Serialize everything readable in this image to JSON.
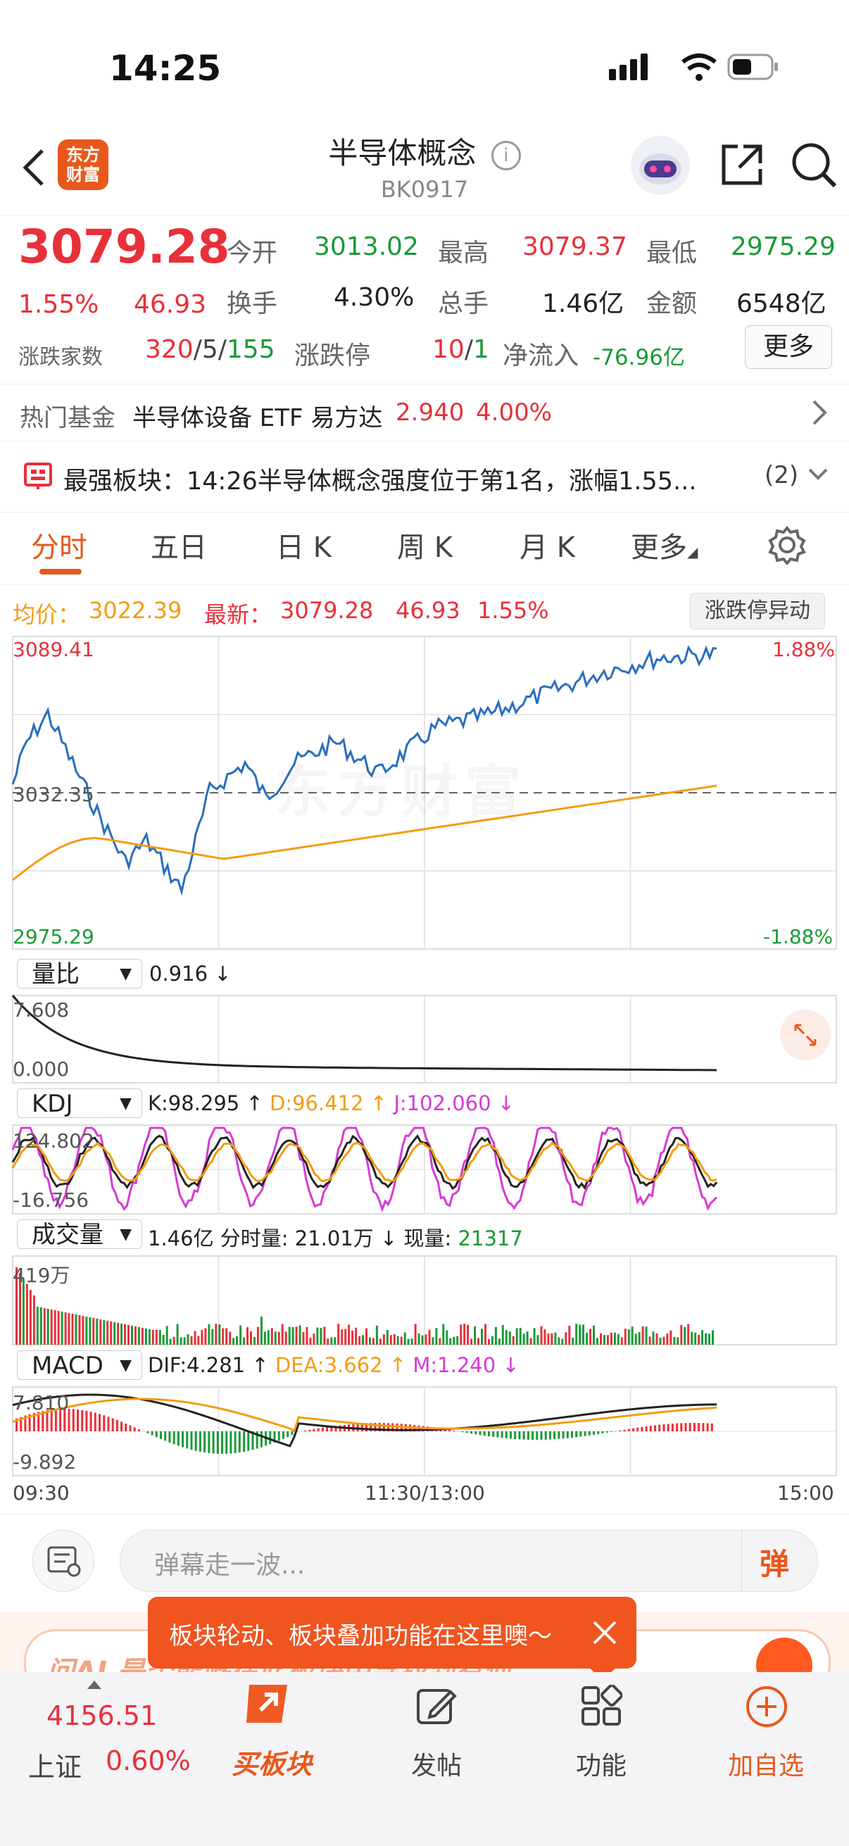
{
  "status_bar": {
    "time": "14:25"
  },
  "header": {
    "logo_text": "东方\n财富",
    "title": "半导体概念",
    "code": "BK0917"
  },
  "quote": {
    "price": "3079.28",
    "change_pct": "1.55%",
    "change_abs": "46.93",
    "open_label": "今开",
    "open": "3013.02",
    "high_label": "最高",
    "high": "3079.37",
    "low_label": "最低",
    "low": "2975.29",
    "turnover_label": "换手",
    "turnover": "4.30%",
    "volume_label": "总手",
    "volume": "1.46亿",
    "amount_label": "金额",
    "amount": "6548亿",
    "breadth_label": "涨跌家数",
    "up": "320",
    "flat": "5",
    "down": "155",
    "limit_label": "涨跌停",
    "limit_up": "10",
    "limit_down": "1",
    "netflow_label": "净流入",
    "netflow": "-76.96亿",
    "more": "更多"
  },
  "hot_fund": {
    "label": "热门基金",
    "name": "半导体设备 ETF 易方达",
    "price": "2.940",
    "pct": "4.00%"
  },
  "notice": {
    "text": "最强板块：14:26半导体概念强度位于第1名，涨幅1.55...",
    "count": "(2)"
  },
  "tabs": [
    {
      "label": "分时"
    },
    {
      "label": "五日"
    },
    {
      "label": "日 K"
    },
    {
      "label": "周 K"
    },
    {
      "label": "月 K"
    },
    {
      "label": "更多"
    }
  ],
  "intraday": {
    "avg_label": "均价：",
    "avg": "3022.39",
    "latest_label": "最新：",
    "latest": "3079.28",
    "latest_chg": "46.93",
    "latest_pct": "1.55%",
    "limit_button": "涨跌停异动",
    "y_max": "3089.41",
    "y_mid": "3032.35",
    "y_min": "2975.29",
    "pct_max": "1.88%",
    "pct_min": "-1.88%",
    "watermark": "东方财富"
  },
  "indicators": {
    "lb": {
      "name": "量比",
      "value": "0.916 ↓",
      "top": "7.608",
      "bottom": "0.000"
    },
    "kdj": {
      "name": "KDJ",
      "k": "K:98.295 ↑",
      "d": "D:96.412 ↑",
      "j": "J:102.060 ↓",
      "top": "124.802",
      "bottom": "-16.756"
    },
    "vol": {
      "name": "成交量",
      "total": "1.46亿",
      "minute_label": "分时量: 21.01万 ↓",
      "now_label": "现量:",
      "now": "21317",
      "top": "419万"
    },
    "macd": {
      "name": "MACD",
      "dif": "DIF:4.281 ↑",
      "dea": "DEA:3.662 ↑",
      "m": "M:1.240 ↓",
      "top": "7.810",
      "bottom": "-9.892"
    }
  },
  "time_axis": {
    "start": "09:30",
    "mid": "11:30/13:00",
    "end": "15:00"
  },
  "comment": {
    "placeholder": "弹幕走一波...",
    "danmu_icon_text": "弹"
  },
  "tooltip": {
    "text": "板块轮动、板块叠加功能在这里噢～"
  },
  "ai_strip": {
    "text": "问AI 是否能够在此板块中寻找到有何"
  },
  "bottom_nav": {
    "index_value": "4156.51",
    "index_name": "上证",
    "index_pct": "0.60%",
    "items": [
      {
        "label": "买板块"
      },
      {
        "label": "发帖"
      },
      {
        "label": "功能"
      },
      {
        "label": "加自选"
      }
    ]
  },
  "colors": {
    "up": "#e8303a",
    "down": "#1a9a37",
    "accent": "#e8581c",
    "avg_line": "#f39c12",
    "price_line": "#2a6ebd"
  }
}
